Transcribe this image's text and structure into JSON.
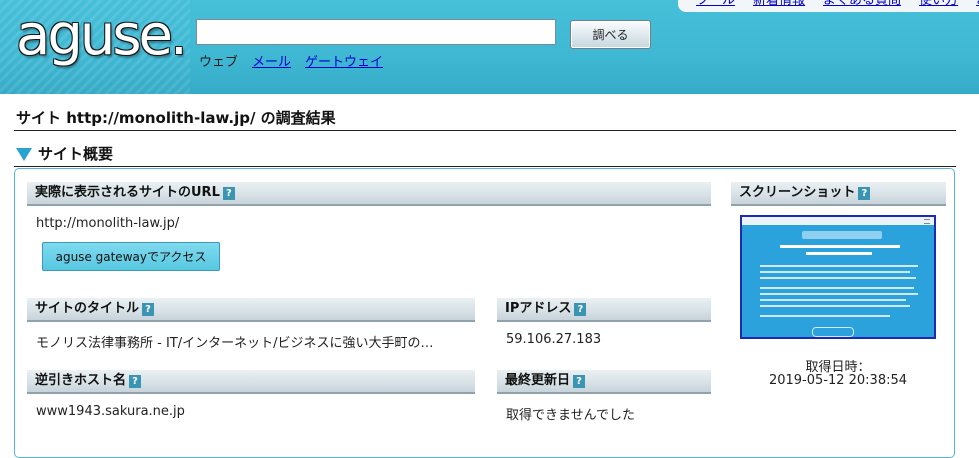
{
  "header": {
    "logo": "aguse.",
    "search_value": "",
    "search_button": "調べる",
    "search_types": {
      "web": "ウェブ",
      "mail": "メール",
      "gateway": "ゲートウェイ"
    },
    "top_nav": [
      "ツール",
      "新着情報",
      "よくある質問",
      "使い方",
      "お"
    ]
  },
  "page_title": "サイト http://monolith-law.jp/ の調査結果",
  "section_heading": "サイト概要",
  "fields": {
    "url": {
      "label": "実際に表示されるサイトのURL",
      "value": "http://monolith-law.jp/",
      "button": "aguse gatewayでアクセス"
    },
    "title": {
      "label": "サイトのタイトル",
      "value": "モノリス法律事務所 - IT/インターネット/ビジネスに強い大手町の…"
    },
    "ip": {
      "label": "IPアドレス",
      "value": "59.106.27.183"
    },
    "reverse_host": {
      "label": "逆引きホスト名",
      "value": "www1943.sakura.ne.jp"
    },
    "last_updated": {
      "label": "最終更新日",
      "value": "取得できませんでした"
    },
    "screenshot": {
      "label": "スクリーンショット",
      "captured_label": "取得日時：",
      "captured_value": "2019-05-12 20:38:54"
    }
  },
  "help_icon_text": "?",
  "colors": {
    "header_bg": "#3fb8d3",
    "link": "#0000d0",
    "accent": "#2aa3cf",
    "gateway_button": "#57c8e2",
    "thumbnail_bg": "#2ca2dc"
  }
}
